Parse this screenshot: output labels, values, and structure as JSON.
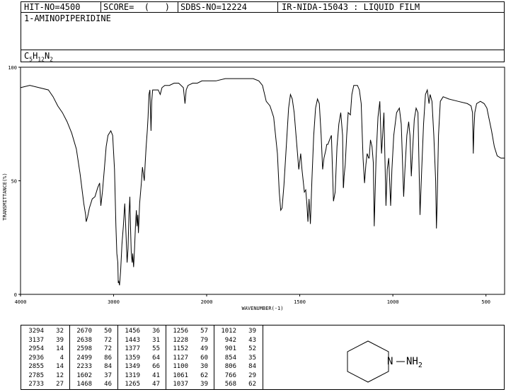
{
  "header": {
    "hit_no": "HIT-NO=4500",
    "score": "SCORE=  (   )",
    "sdbs_no": "SDBS-NO=12224",
    "ir_info": "IR-NIDA-15043 : LIQUID FILM"
  },
  "compound_name": "1-AMINOPIPERIDINE",
  "formula": {
    "c": "C",
    "c_n": "5",
    "h": "H",
    "h_n": "12",
    "n": "N",
    "n_n": "2"
  },
  "structure": {
    "nh2_label": "N–NH",
    "nh2_sub": "2",
    "ring_n_label": "N"
  },
  "colors": {
    "line": "#000000",
    "background": "#ffffff"
  },
  "chart_data": {
    "type": "line",
    "title": "",
    "xlabel": "WAVENUMBER(-1)",
    "ylabel": "TRANSMITTANCE(%)",
    "xlim": [
      4000,
      400
    ],
    "ylim": [
      0,
      100
    ],
    "x_ticks": [
      4000,
      3000,
      2000,
      1500,
      1000,
      500
    ],
    "y_ticks": [
      0,
      50,
      100
    ],
    "grid": false,
    "series": [
      {
        "name": "",
        "points": [
          [
            4000,
            91
          ],
          [
            3900,
            92
          ],
          [
            3800,
            91
          ],
          [
            3700,
            90
          ],
          [
            3650,
            87
          ],
          [
            3600,
            83
          ],
          [
            3550,
            80
          ],
          [
            3500,
            76
          ],
          [
            3450,
            71
          ],
          [
            3400,
            64
          ],
          [
            3360,
            53
          ],
          [
            3320,
            40
          ],
          [
            3300,
            35
          ],
          [
            3294,
            32
          ],
          [
            3280,
            34
          ],
          [
            3260,
            38
          ],
          [
            3230,
            42
          ],
          [
            3200,
            43
          ],
          [
            3170,
            47
          ],
          [
            3150,
            49
          ],
          [
            3137,
            39
          ],
          [
            3120,
            45
          ],
          [
            3100,
            55
          ],
          [
            3080,
            65
          ],
          [
            3060,
            70
          ],
          [
            3030,
            72
          ],
          [
            3010,
            70
          ],
          [
            2990,
            55
          ],
          [
            2975,
            30
          ],
          [
            2965,
            18
          ],
          [
            2954,
            14
          ],
          [
            2950,
            5
          ],
          [
            2945,
            6
          ],
          [
            2936,
            4
          ],
          [
            2925,
            10
          ],
          [
            2910,
            22
          ],
          [
            2895,
            30
          ],
          [
            2880,
            40
          ],
          [
            2870,
            30
          ],
          [
            2855,
            14
          ],
          [
            2845,
            20
          ],
          [
            2835,
            35
          ],
          [
            2825,
            43
          ],
          [
            2818,
            30
          ],
          [
            2810,
            18
          ],
          [
            2800,
            14
          ],
          [
            2795,
            18
          ],
          [
            2785,
            12
          ],
          [
            2775,
            20
          ],
          [
            2765,
            30
          ],
          [
            2755,
            37
          ],
          [
            2748,
            30
          ],
          [
            2740,
            35
          ],
          [
            2733,
            27
          ],
          [
            2720,
            40
          ],
          [
            2700,
            50
          ],
          [
            2690,
            56
          ],
          [
            2680,
            53
          ],
          [
            2670,
            50
          ],
          [
            2660,
            58
          ],
          [
            2650,
            65
          ],
          [
            2638,
            72
          ],
          [
            2630,
            78
          ],
          [
            2620,
            88
          ],
          [
            2610,
            90
          ],
          [
            2598,
            72
          ],
          [
            2590,
            85
          ],
          [
            2580,
            90
          ],
          [
            2550,
            90
          ],
          [
            2520,
            90
          ],
          [
            2499,
            88
          ],
          [
            2480,
            91
          ],
          [
            2450,
            92
          ],
          [
            2400,
            92
          ],
          [
            2350,
            93
          ],
          [
            2300,
            93
          ],
          [
            2250,
            91
          ],
          [
            2233,
            84
          ],
          [
            2220,
            90
          ],
          [
            2200,
            92
          ],
          [
            2150,
            93
          ],
          [
            2100,
            93
          ],
          [
            2050,
            94
          ],
          [
            2000,
            94
          ],
          [
            1950,
            94
          ],
          [
            1900,
            95
          ],
          [
            1850,
            95
          ],
          [
            1800,
            95
          ],
          [
            1750,
            95
          ],
          [
            1720,
            94
          ],
          [
            1700,
            92
          ],
          [
            1680,
            85
          ],
          [
            1660,
            83
          ],
          [
            1640,
            78
          ],
          [
            1620,
            62
          ],
          [
            1610,
            45
          ],
          [
            1602,
            37
          ],
          [
            1595,
            38
          ],
          [
            1585,
            48
          ],
          [
            1570,
            68
          ],
          [
            1560,
            82
          ],
          [
            1550,
            88
          ],
          [
            1540,
            86
          ],
          [
            1530,
            80
          ],
          [
            1515,
            65
          ],
          [
            1505,
            55
          ],
          [
            1495,
            62
          ],
          [
            1488,
            55
          ],
          [
            1475,
            45
          ],
          [
            1468,
            46
          ],
          [
            1462,
            40
          ],
          [
            1456,
            32
          ],
          [
            1450,
            42
          ],
          [
            1443,
            31
          ],
          [
            1435,
            50
          ],
          [
            1425,
            70
          ],
          [
            1415,
            82
          ],
          [
            1405,
            86
          ],
          [
            1395,
            84
          ],
          [
            1385,
            70
          ],
          [
            1377,
            55
          ],
          [
            1370,
            60
          ],
          [
            1359,
            64
          ],
          [
            1355,
            66
          ],
          [
            1349,
            66
          ],
          [
            1340,
            68
          ],
          [
            1330,
            70
          ],
          [
            1319,
            41
          ],
          [
            1310,
            45
          ],
          [
            1300,
            65
          ],
          [
            1290,
            75
          ],
          [
            1280,
            80
          ],
          [
            1270,
            70
          ],
          [
            1266,
            47
          ],
          [
            1265,
            47
          ],
          [
            1262,
            52
          ],
          [
            1256,
            57
          ],
          [
            1248,
            70
          ],
          [
            1240,
            80
          ],
          [
            1228,
            79
          ],
          [
            1220,
            88
          ],
          [
            1210,
            92
          ],
          [
            1200,
            92
          ],
          [
            1190,
            92
          ],
          [
            1180,
            90
          ],
          [
            1170,
            84
          ],
          [
            1160,
            60
          ],
          [
            1152,
            49
          ],
          [
            1145,
            57
          ],
          [
            1138,
            62
          ],
          [
            1130,
            60
          ],
          [
            1127,
            60
          ],
          [
            1120,
            68
          ],
          [
            1112,
            65
          ],
          [
            1105,
            58
          ],
          [
            1100,
            30
          ],
          [
            1090,
            60
          ],
          [
            1080,
            78
          ],
          [
            1070,
            85
          ],
          [
            1061,
            62
          ],
          [
            1055,
            70
          ],
          [
            1048,
            80
          ],
          [
            1037,
            39
          ],
          [
            1030,
            55
          ],
          [
            1022,
            60
          ],
          [
            1012,
            39
          ],
          [
            1005,
            55
          ],
          [
            995,
            70
          ],
          [
            980,
            80
          ],
          [
            965,
            82
          ],
          [
            955,
            75
          ],
          [
            942,
            43
          ],
          [
            935,
            55
          ],
          [
            925,
            70
          ],
          [
            915,
            76
          ],
          [
            908,
            70
          ],
          [
            901,
            52
          ],
          [
            895,
            62
          ],
          [
            885,
            77
          ],
          [
            875,
            82
          ],
          [
            865,
            80
          ],
          [
            854,
            35
          ],
          [
            845,
            55
          ],
          [
            835,
            75
          ],
          [
            825,
            88
          ],
          [
            815,
            90
          ],
          [
            806,
            84
          ],
          [
            800,
            88
          ],
          [
            790,
            85
          ],
          [
            780,
            70
          ],
          [
            770,
            50
          ],
          [
            766,
            29
          ],
          [
            762,
            40
          ],
          [
            755,
            70
          ],
          [
            745,
            85
          ],
          [
            730,
            87
          ],
          [
            700,
            86
          ],
          [
            650,
            85
          ],
          [
            600,
            84
          ],
          [
            580,
            83
          ],
          [
            572,
            80
          ],
          [
            568,
            62
          ],
          [
            565,
            72
          ],
          [
            560,
            80
          ],
          [
            550,
            84
          ],
          [
            530,
            85
          ],
          [
            510,
            84
          ],
          [
            495,
            82
          ],
          [
            485,
            78
          ],
          [
            470,
            72
          ],
          [
            455,
            65
          ],
          [
            440,
            61
          ],
          [
            420,
            60
          ],
          [
            400,
            60
          ]
        ]
      }
    ]
  },
  "peak_table": {
    "columns": [
      [
        [
          "3294",
          "32"
        ],
        [
          "3137",
          "39"
        ],
        [
          "2954",
          "14"
        ],
        [
          "2936",
          "4"
        ],
        [
          "2855",
          "14"
        ],
        [
          "2785",
          "12"
        ],
        [
          "2733",
          "27"
        ]
      ],
      [
        [
          "2670",
          "50"
        ],
        [
          "2638",
          "72"
        ],
        [
          "2598",
          "72"
        ],
        [
          "2499",
          "86"
        ],
        [
          "2233",
          "84"
        ],
        [
          "1602",
          "37"
        ],
        [
          "1468",
          "46"
        ]
      ],
      [
        [
          "1456",
          "36"
        ],
        [
          "1443",
          "31"
        ],
        [
          "1377",
          "55"
        ],
        [
          "1359",
          "64"
        ],
        [
          "1349",
          "66"
        ],
        [
          "1319",
          "41"
        ],
        [
          "1265",
          "47"
        ]
      ],
      [
        [
          "1256",
          "57"
        ],
        [
          "1228",
          "79"
        ],
        [
          "1152",
          "49"
        ],
        [
          "1127",
          "60"
        ],
        [
          "1100",
          "30"
        ],
        [
          "1061",
          "62"
        ],
        [
          "1037",
          "39"
        ]
      ],
      [
        [
          "1012",
          "39"
        ],
        [
          "942",
          "43"
        ],
        [
          "901",
          "52"
        ],
        [
          "854",
          "35"
        ],
        [
          "806",
          "84"
        ],
        [
          "766",
          "29"
        ],
        [
          "568",
          "62"
        ]
      ]
    ]
  }
}
